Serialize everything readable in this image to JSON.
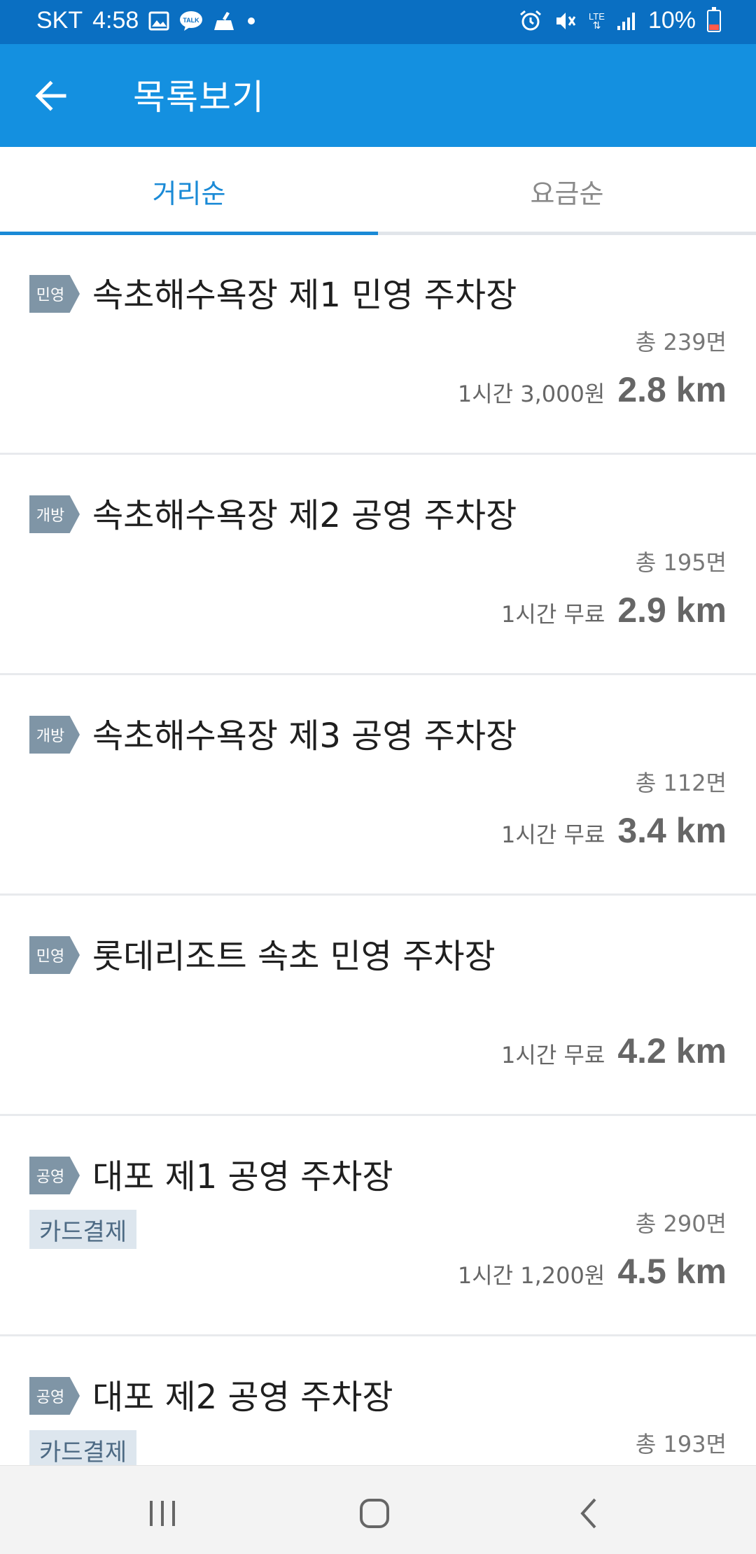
{
  "status_bar": {
    "carrier": "SKT",
    "time": "4:58",
    "network": "LTE",
    "battery": "10%",
    "left_icons": [
      "image-icon",
      "kakaotalk-icon",
      "cleaner-icon",
      "dot-icon"
    ],
    "right_icons": [
      "alarm-icon",
      "mute-icon",
      "lte-icon",
      "signal-icon",
      "battery-icon"
    ]
  },
  "app_bar": {
    "back_icon": "arrow-left-icon",
    "title": "목록보기"
  },
  "tabs": [
    {
      "label": "거리순",
      "selected": true
    },
    {
      "label": "요금순",
      "selected": false
    }
  ],
  "colors": {
    "status_bar": "#0a6fc2",
    "app_bar": "#1490e0",
    "accent": "#1a8ad6",
    "badge": "#7f95a6",
    "chip_bg": "#dde6ee",
    "chip_text": "#4d6a84"
  },
  "parking_lots": [
    {
      "badge": "민영",
      "name": "속초해수욕장 제1 민영 주차장",
      "total": "총 239면",
      "price": "1시간 3,000원",
      "distance": "2.8 km"
    },
    {
      "badge": "개방",
      "name": "속초해수욕장 제2 공영 주차장",
      "total": "총 195면",
      "price": "1시간 무료",
      "distance": "2.9 km"
    },
    {
      "badge": "개방",
      "name": "속초해수욕장 제3 공영 주차장",
      "total": "총 112면",
      "price": "1시간 무료",
      "distance": "3.4 km"
    },
    {
      "badge": "민영",
      "name": "롯데리조트 속초 민영 주차장",
      "price": "1시간 무료",
      "distance": "4.2 km"
    },
    {
      "badge": "공영",
      "name": "대포 제1 공영 주차장",
      "chip": "카드결제",
      "total": "총 290면",
      "price": "1시간 1,200원",
      "distance": "4.5 km"
    },
    {
      "badge": "공영",
      "name": "대포 제2 공영 주차장",
      "chip": "카드결제",
      "total": "총 193면"
    }
  ],
  "nav_bar": {
    "buttons": [
      "recent-apps-icon",
      "home-icon",
      "back-icon"
    ]
  }
}
